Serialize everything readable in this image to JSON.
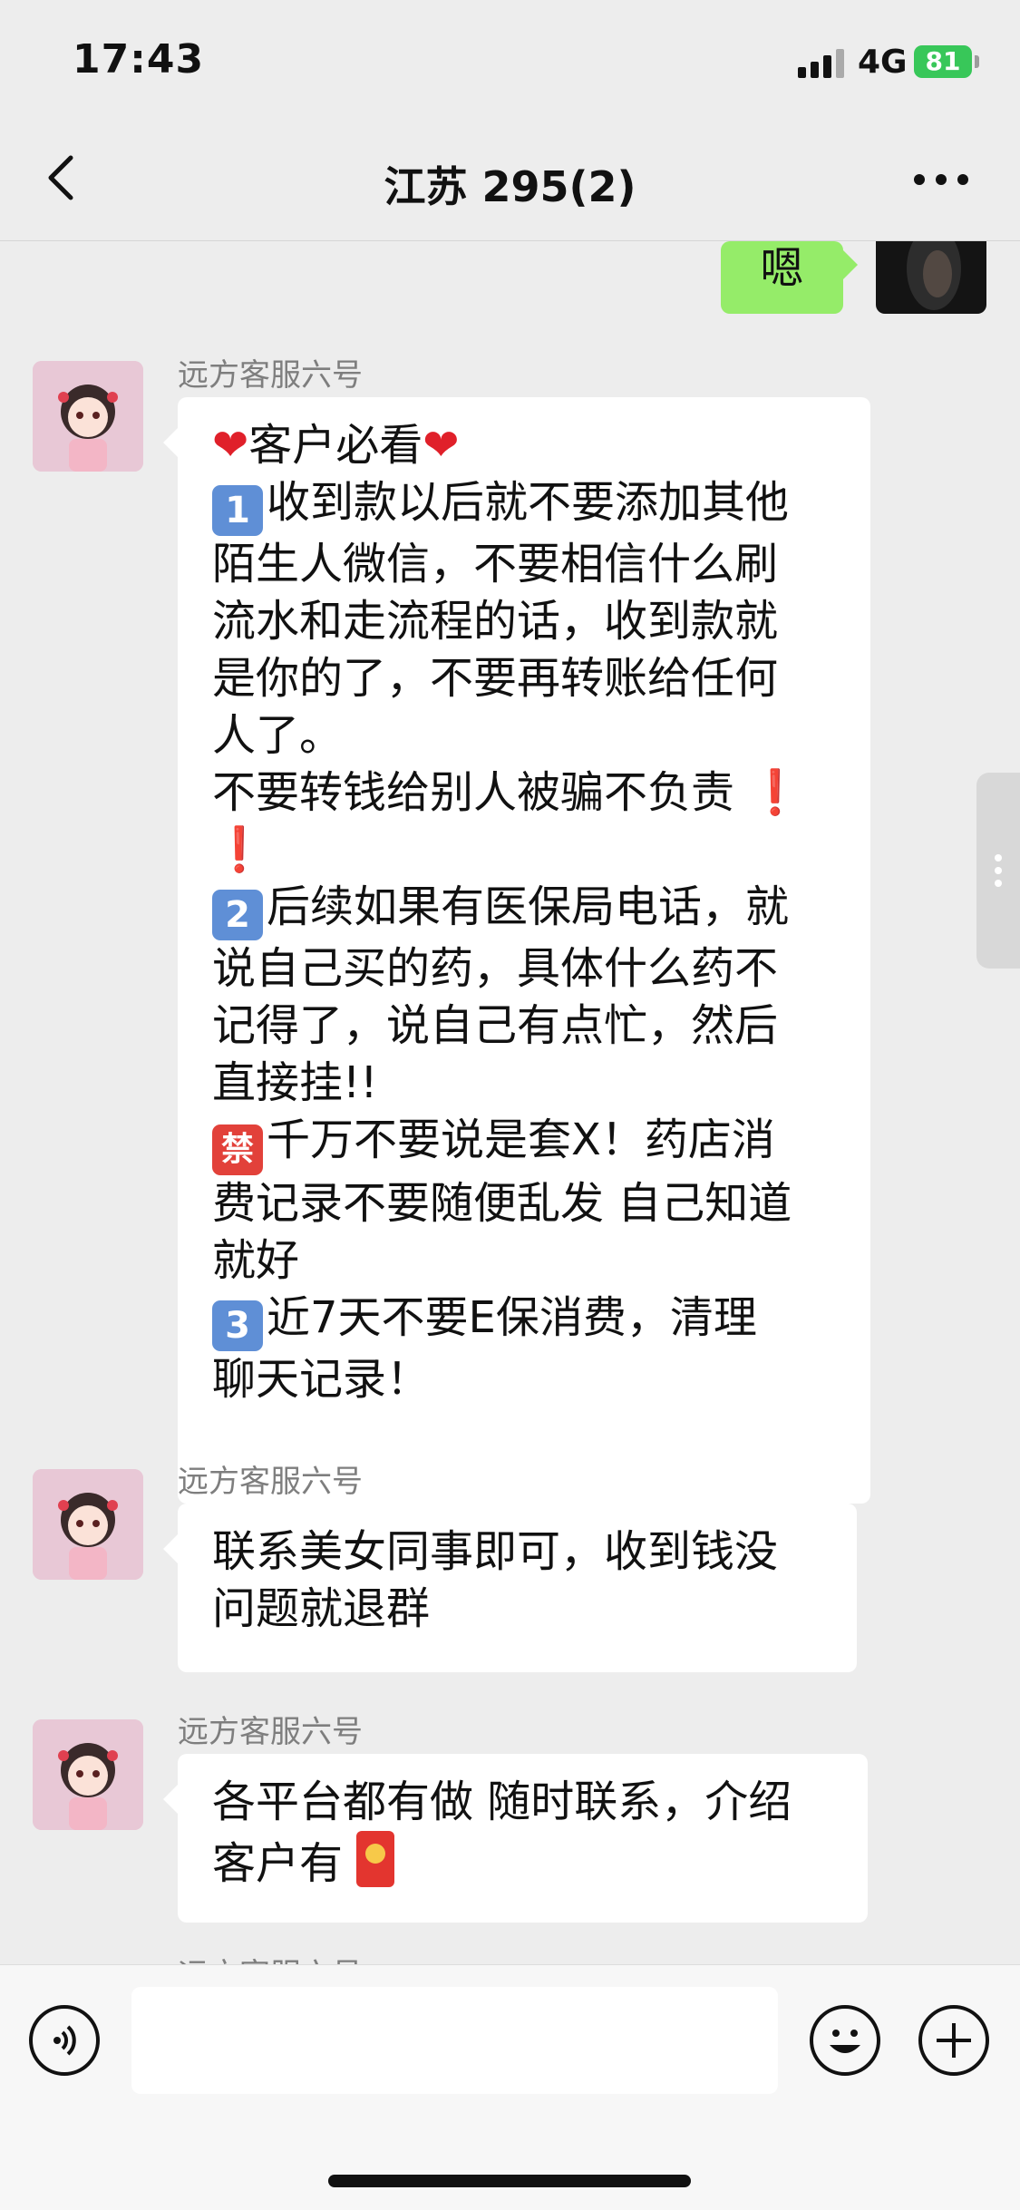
{
  "status_bar": {
    "time": "17:43",
    "network": "4G",
    "battery": "81"
  },
  "nav": {
    "title": "江苏 295(2)"
  },
  "own_message": {
    "text": "嗯"
  },
  "messages": [
    {
      "sender": "远方客服六号",
      "lines": {
        "l1": "客户必看",
        "l2": "收到款以后就不要添加其他",
        "l3": "陌生人微信，不要相信什么刷",
        "l4": "流水和走流程的话，收到款就",
        "l5": "是你的了，不要再转账给任何",
        "l6": "人了。",
        "l7": "不要转钱给别人被骗不负责",
        "l8": "后续如果有医保局电话，就",
        "l9": "说自己买的药，具体什么药不",
        "l10": "记得了，说自己有点忙，然后",
        "l11": "直接挂!!",
        "l12": "千万不要说是套X！药店消",
        "l13": "费记录不要随便乱发 自己知道",
        "l14": "就好",
        "l15": "近7天不要E保消费，清理",
        "l16": "聊天记录！"
      },
      "badges": {
        "n1": "1",
        "n2": "2",
        "n3": "3",
        "ban": "禁"
      }
    },
    {
      "sender": "远方客服六号",
      "lines": {
        "l1": "联系美女同事即可，收到钱没",
        "l2": "问题就退群"
      }
    },
    {
      "sender": "远方客服六号",
      "lines": {
        "l1": "各平台都有做 随时联系，介绍",
        "l2": "客户有"
      }
    }
  ],
  "partial_sender": "远方客服六号",
  "colors": {
    "background": "#ededed",
    "own_bubble": "#95ec69",
    "battery": "#38c759",
    "emphasis": "#e0202a"
  },
  "icons": [
    "back-chevron-icon",
    "more-dots-icon",
    "voice-icon",
    "emoji-icon",
    "plus-icon",
    "red-packet-icon",
    "heart-icon",
    "exclamation-icon"
  ]
}
